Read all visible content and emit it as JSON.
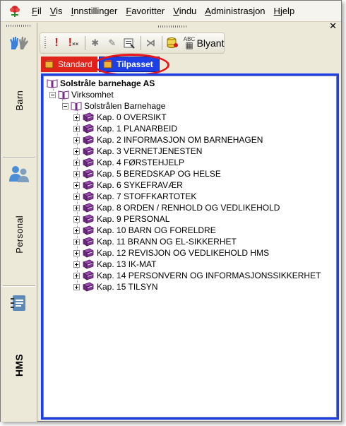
{
  "menubar": {
    "items": [
      {
        "label": "Fil",
        "ul": "F",
        "rest": "il"
      },
      {
        "label": "Vis",
        "ul": "V",
        "rest": "is"
      },
      {
        "label": "Innstillinger",
        "ul": "I",
        "rest": "nnstillinger"
      },
      {
        "label": "Favoritter",
        "ul": "F",
        "rest": "avoritter"
      },
      {
        "label": "Vindu",
        "ul": "V",
        "rest": "indu"
      },
      {
        "label": "Administrasjon",
        "ul": "A",
        "rest": "dministrasjon"
      },
      {
        "label": "Hjelp",
        "ul": "H",
        "rest": "jelp"
      }
    ]
  },
  "sidebar": {
    "barn": "Barn",
    "personal": "Personal",
    "hms": "HMS"
  },
  "toolbar": {
    "pencil_label": "Blyant"
  },
  "tabs": {
    "standard": "Standard",
    "tilpasset": "Tilpasset"
  },
  "tree": {
    "root": "Solstråle barnehage AS",
    "level1": "Virksomhet",
    "level2": "Solstrålen Barnehage",
    "chapters": [
      "Kap. 0  OVERSIKT",
      "Kap. 1   PLANARBEID",
      "Kap. 2   INFORMASJON OM BARNEHAGEN",
      "Kap. 3   VERNETJENESTEN",
      "Kap. 4   FØRSTEHJELP",
      "Kap. 5  BEREDSKAP OG HELSE",
      "Kap. 6   SYKEFRAVÆR",
      "Kap. 7   STOFFKARTOTEK",
      "Kap. 8   ORDEN / RENHOLD OG VEDLIKEHOLD",
      "Kap. 9   PERSONAL",
      "Kap. 10 BARN OG FORELDRE",
      "Kap. 11 BRANN OG EL-SIKKERHET",
      "Kap. 12 REVISJON OG VEDLIKEHOLD HMS",
      "Kap. 13 IK-MAT",
      "Kap. 14  PERSONVERN OG INFORMASJONSSIKKERHET",
      "Kap. 15 TILSYN"
    ]
  },
  "colors": {
    "tab_red": "#e0241c",
    "tab_blue": "#1e3fe6",
    "highlight_ring": "#e81418",
    "book_purple": "#7a2a8a"
  }
}
